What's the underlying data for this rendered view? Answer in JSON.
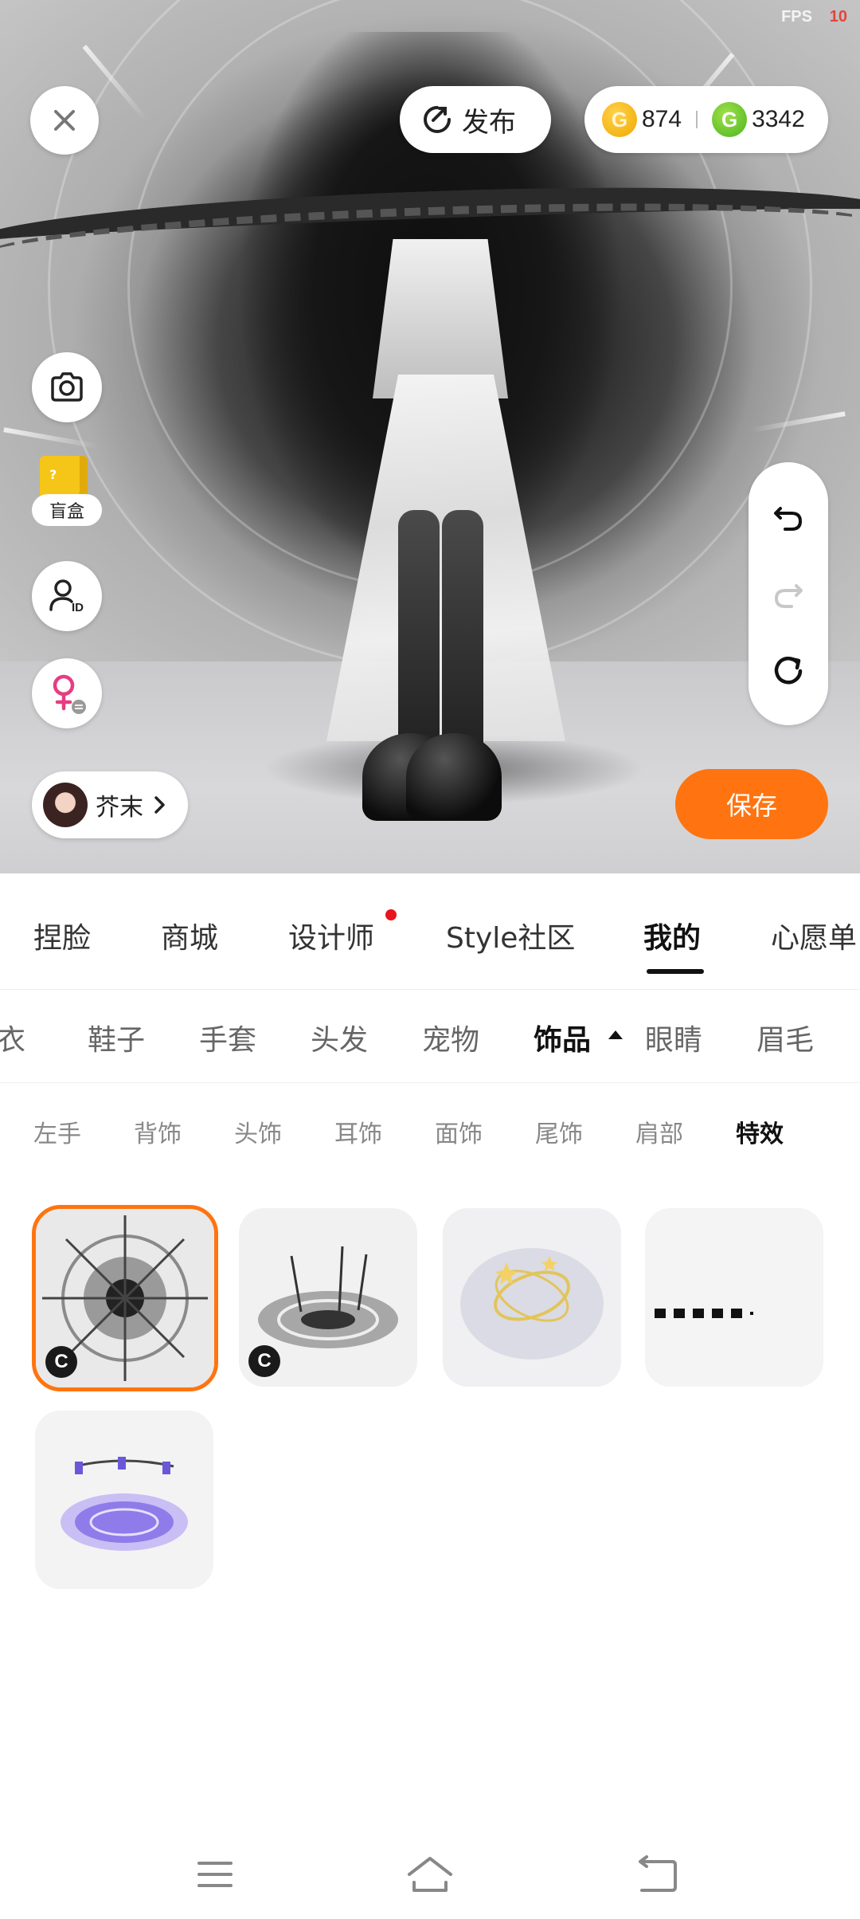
{
  "status": {
    "fps_label": "FPS",
    "fps_value": "10"
  },
  "header": {
    "publish_label": "发布",
    "currency": [
      {
        "icon": "gold-coin-icon",
        "amount": "874"
      },
      {
        "icon": "green-coin-icon",
        "amount": "3342"
      }
    ]
  },
  "left_tools": {
    "blind_box_label": "盲盒"
  },
  "profile": {
    "name": "芥末"
  },
  "actions": {
    "save_label": "保存"
  },
  "tabs_main": {
    "items": [
      "捏脸",
      "商城",
      "设计师",
      "Style社区",
      "我的",
      "心愿单"
    ],
    "active": "我的",
    "notification_on": "设计师"
  },
  "tabs_sub": {
    "items": [
      "衣",
      "鞋子",
      "手套",
      "头发",
      "宠物",
      "饰品",
      "眼睛",
      "眉毛"
    ],
    "active": "饰品"
  },
  "tabs_third": {
    "items": [
      "左手",
      "背饰",
      "头饰",
      "耳饰",
      "面饰",
      "尾饰",
      "肩部",
      "特效"
    ],
    "active": "特效"
  },
  "items": [
    {
      "name": "silver-spike-halo-effect",
      "badge": "C",
      "selected": true
    },
    {
      "name": "dark-rune-circle-effect",
      "badge": "C",
      "selected": false
    },
    {
      "name": "golden-orbit-star-effect",
      "badge": "",
      "selected": false
    },
    {
      "name": "loading-placeholder",
      "badge": "",
      "selected": false
    },
    {
      "name": "purple-magic-circle-effect",
      "badge": "",
      "selected": false
    }
  ],
  "colors": {
    "accent": "#ff7410",
    "notification": "#e8141e",
    "gold": "#f0a800",
    "green": "#4cb51f"
  }
}
